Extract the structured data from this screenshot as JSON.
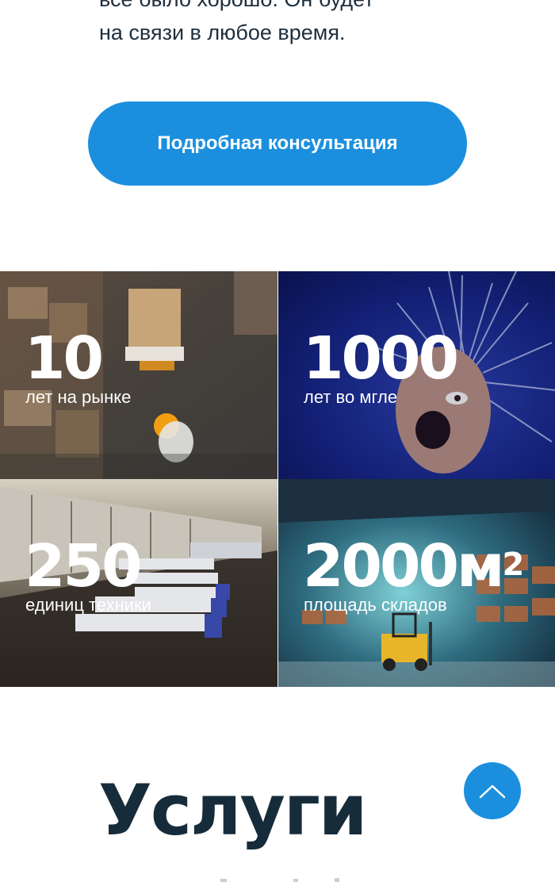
{
  "intro": {
    "line1": "все было хорошо. Он будет",
    "line2": "на связи в любое время."
  },
  "cta": {
    "label": "Подробная консультация"
  },
  "stats": [
    {
      "number": "10",
      "label": "лет на рынке",
      "image": "warehouse-worker-pallet-photo"
    },
    {
      "number": "1000",
      "label": "лет во мгле",
      "image": "screaming-man-photo"
    },
    {
      "number": "250",
      "label": "единиц техники",
      "image": "trucks-at-docks-photo"
    },
    {
      "number": "2000м",
      "number_sup": "2",
      "label": "площадь складов",
      "image": "forklift-warehouse-photo"
    }
  ],
  "services": {
    "title": "Услуги"
  },
  "scroll_top": {
    "icon": "chevron-up-icon"
  },
  "colors": {
    "accent": "#1b8fde",
    "heading": "#172c3b",
    "text": "#1e2f3d"
  }
}
